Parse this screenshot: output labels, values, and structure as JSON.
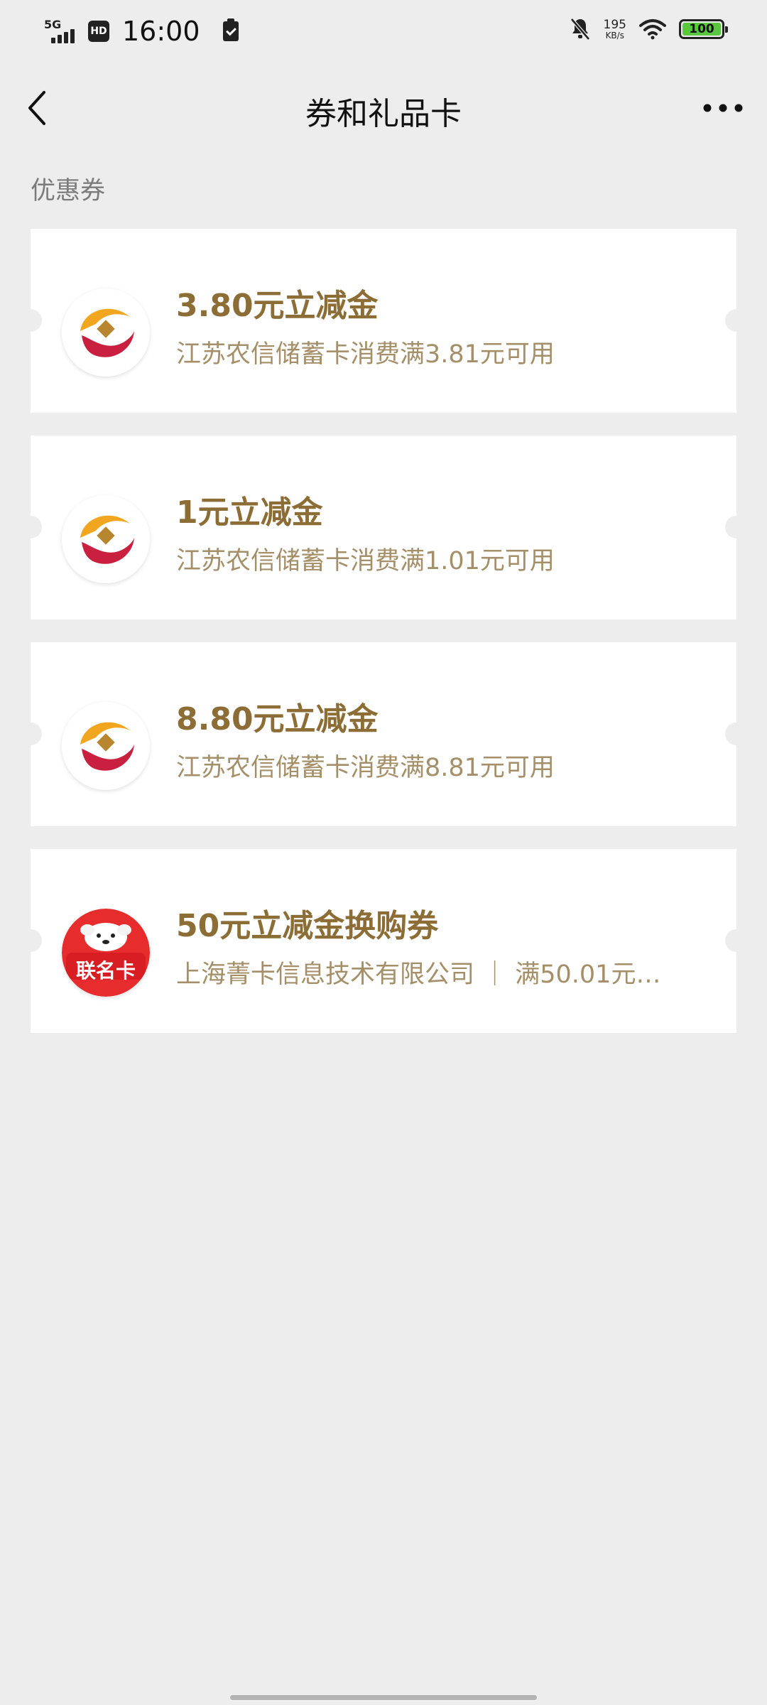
{
  "status_bar": {
    "network": "5G",
    "hd": "HD",
    "time": "16:00",
    "speed_value": "195",
    "speed_unit": "KB/s",
    "battery": "100"
  },
  "nav": {
    "title": "券和礼品卡"
  },
  "section": {
    "label": "优惠券"
  },
  "coupons": [
    {
      "title": "3.80元立减金",
      "desc": "江苏农信储蓄卡消费满3.81元可用",
      "logo": "jiangsu-rural-credit-logo"
    },
    {
      "title": "1元立减金",
      "desc": "江苏农信储蓄卡消费满1.01元可用",
      "logo": "jiangsu-rural-credit-logo"
    },
    {
      "title": "8.80元立减金",
      "desc": "江苏农信储蓄卡消费满8.81元可用",
      "logo": "jiangsu-rural-credit-logo"
    },
    {
      "title": "50元立减金换购券",
      "desc": "上海菁卡信息技术有限公司 ｜ 满50.01元…",
      "logo": "joint-card-logo",
      "logo_text": "联名卡"
    }
  ],
  "colors": {
    "background": "#ededed",
    "card": "#ffffff",
    "title": "#8c6d36",
    "desc": "#a58f68",
    "battery": "#5ac83e",
    "joint_card_red": "#e62c2c"
  }
}
